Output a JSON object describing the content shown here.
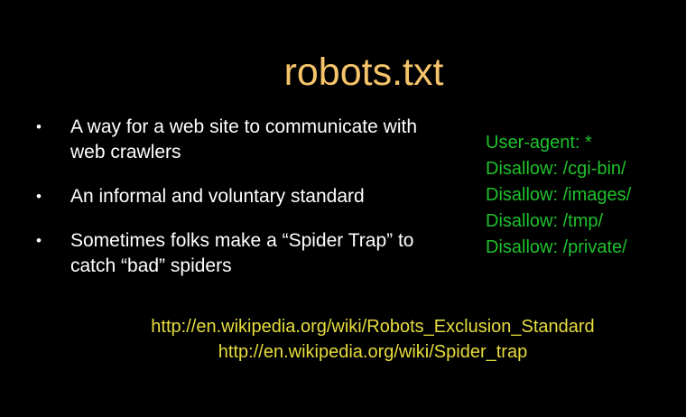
{
  "slide": {
    "title": "robots.txt",
    "bullets": [
      {
        "text": "A way for a web site to communicate with web crawlers"
      },
      {
        "text": "An informal and voluntary standard"
      },
      {
        "text": "Sometimes folks make a “Spider Trap” to catch “bad” spiders"
      }
    ],
    "bullet_glyph": "•",
    "robots_file": {
      "lines": [
        "User-agent: *",
        "Disallow: /cgi-bin/",
        "Disallow: /images/",
        "Disallow: /tmp/",
        "Disallow: /private/"
      ]
    },
    "links": [
      "http://en.wikipedia.org/wiki/Robots_Exclusion_Standard",
      "http://en.wikipedia.org/wiki/Spider_trap"
    ]
  },
  "colors": {
    "background": "#000000",
    "title": "#f5c46a",
    "bullet_text": "#ffffff",
    "robots_text": "#21c12d",
    "link_text": "#e7dd3e"
  }
}
